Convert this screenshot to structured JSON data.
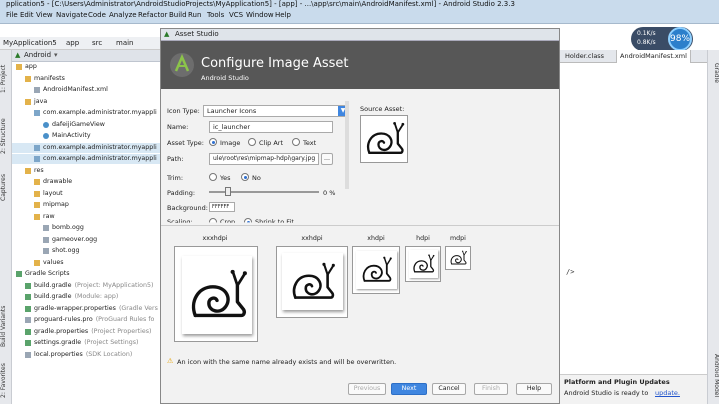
{
  "window": {
    "title": "pplication5 - [C:\\Users\\Administrator\\AndroidStudioProjects\\MyApplication5] - [app] - ...\\app\\src\\main\\AndroidManifest.xml] - Android Studio 2.3.3"
  },
  "menu": [
    "File",
    "Edit",
    "View",
    "Navigate",
    "Code",
    "Analyze",
    "Refactor",
    "Build",
    "Run",
    "Tools",
    "VCS",
    "Window",
    "Help"
  ],
  "perf": {
    "line1": "0.1K/s",
    "line2": "0.8K/s",
    "percent": "98%"
  },
  "breadcrumb": [
    "MyApplication5",
    "app",
    "src",
    "main"
  ],
  "project": {
    "selector": "Android",
    "tree": [
      {
        "label": "app",
        "indent": 0,
        "icon": "folder"
      },
      {
        "label": "manifests",
        "indent": 1,
        "icon": "folder"
      },
      {
        "label": "AndroidManifest.xml",
        "indent": 2,
        "icon": "file"
      },
      {
        "label": "java",
        "indent": 1,
        "icon": "folder"
      },
      {
        "label": "com.example.administrator.myappli",
        "indent": 2,
        "icon": "package"
      },
      {
        "label": "dafeijiGameView",
        "indent": 3,
        "icon": "class"
      },
      {
        "label": "MainActivity",
        "indent": 3,
        "icon": "class"
      },
      {
        "label": "com.example.administrator.myappli",
        "indent": 2,
        "icon": "package",
        "selected": true
      },
      {
        "label": "com.example.administrator.myappli",
        "indent": 2,
        "icon": "package",
        "selected": true
      },
      {
        "label": "res",
        "indent": 1,
        "icon": "folder"
      },
      {
        "label": "drawable",
        "indent": 2,
        "icon": "folder"
      },
      {
        "label": "layout",
        "indent": 2,
        "icon": "folder"
      },
      {
        "label": "mipmap",
        "indent": 2,
        "icon": "folder"
      },
      {
        "label": "raw",
        "indent": 2,
        "icon": "folder"
      },
      {
        "label": "bomb.ogg",
        "indent": 3,
        "icon": "file"
      },
      {
        "label": "gameover.ogg",
        "indent": 3,
        "icon": "file"
      },
      {
        "label": "shot.ogg",
        "indent": 3,
        "icon": "file"
      },
      {
        "label": "values",
        "indent": 2,
        "icon": "folder"
      },
      {
        "label": "Gradle Scripts",
        "indent": 0,
        "icon": "gradle"
      },
      {
        "label": "build.gradle",
        "hint": "(Project: MyApplication5)",
        "indent": 1,
        "icon": "gradle"
      },
      {
        "label": "build.gradle",
        "hint": "(Module: app)",
        "indent": 1,
        "icon": "gradle"
      },
      {
        "label": "gradle-wrapper.properties",
        "hint": "(Gradle Vers",
        "indent": 1,
        "icon": "gradle"
      },
      {
        "label": "proguard-rules.pro",
        "hint": "(ProGuard Rules fo",
        "indent": 1,
        "icon": "file"
      },
      {
        "label": "gradle.properties",
        "hint": "(Project Properties)",
        "indent": 1,
        "icon": "gradle"
      },
      {
        "label": "settings.gradle",
        "hint": "(Project Settings)",
        "indent": 1,
        "icon": "gradle"
      },
      {
        "label": "local.properties",
        "hint": "(SDK Location)",
        "indent": 1,
        "icon": "file"
      }
    ]
  },
  "left_tabs": [
    "1: Project",
    "2: Structure",
    "Captures",
    "Build Variants",
    "2: Favorites"
  ],
  "right_tabs": [
    "Gradle",
    "Android Model"
  ],
  "editor": {
    "tabs": [
      "Holder.class",
      "AndroidManifest.xml"
    ],
    "snippet": "/>",
    "notification_title": "Platform and Plugin Updates",
    "notification_text": "Android Studio is ready to",
    "notification_link": "update."
  },
  "dialog": {
    "title": "Asset Studio",
    "heading": "Configure Image Asset",
    "subheading": "Android Studio",
    "fields": {
      "icon_type_label": "Icon Type:",
      "icon_type_value": "Launcher Icons",
      "name_label": "Name:",
      "name_value": "ic_launcher",
      "asset_type_label": "Asset Type:",
      "asset_image": "Image",
      "asset_clipart": "Clip Art",
      "asset_text": "Text",
      "path_label": "Path:",
      "path_value": "ule\\root\\res\\mipmap-hdpi\\gary.jpg",
      "path_browse": "...",
      "trim_label": "Trim:",
      "trim_yes": "Yes",
      "trim_no": "No",
      "padding_label": "Padding:",
      "padding_value": "0 %",
      "padding_level": 0,
      "background_label": "Background:",
      "background_value": "FFFFFF",
      "scaling_label": "Scaling:",
      "scaling_crop": "Crop",
      "scaling_shrink": "Shrink to Fit"
    },
    "source_asset_label": "Source Asset:",
    "densities": [
      "xxxhdpi",
      "xxhdpi",
      "xhdpi",
      "hdpi",
      "mdpi"
    ],
    "warning": "An icon with the same name already exists and will be overwritten.",
    "buttons": {
      "previous": "Previous",
      "next": "Next",
      "cancel": "Cancel",
      "finish": "Finish",
      "help": "Help"
    },
    "colors": {
      "accent": "#3f86e0",
      "banner": "#575757",
      "android_green": "#8bc34a"
    }
  }
}
